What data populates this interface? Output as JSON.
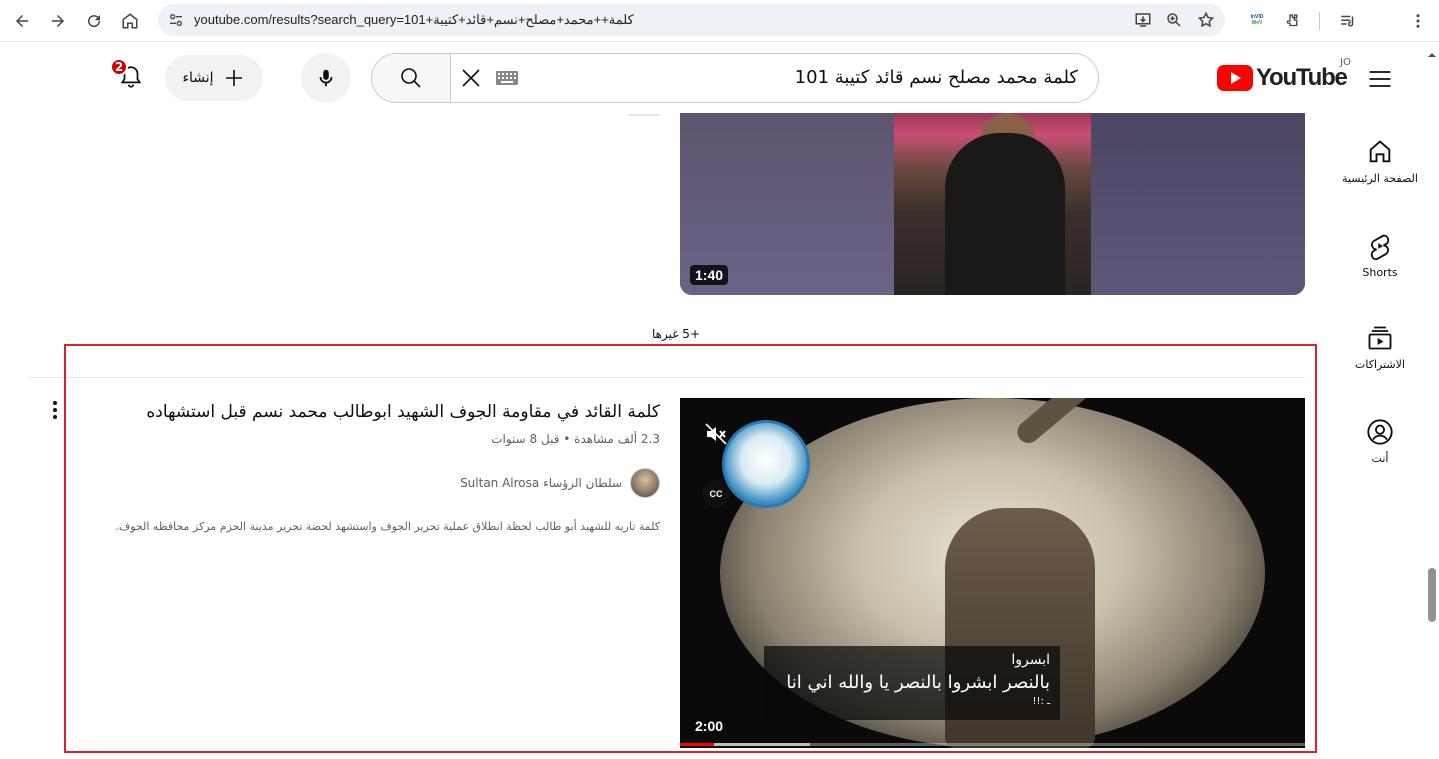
{
  "browser": {
    "url": "youtube.com/results?search_query=101+كلمة++محمد+مصلح+نسم+قائد+كتيبة",
    "ext_badge": "InVID WeVerify"
  },
  "header": {
    "search_value": "كلمة  محمد مصلح نسم قائد كتيبة 101",
    "create_label": "إنشاء",
    "notification_count": "2",
    "logo_text": "YouTube",
    "country_code": "JO"
  },
  "rail": {
    "home": "الصفحة الرئيسية",
    "shorts": "Shorts",
    "subscriptions": "الاشتراكات",
    "you": "أنت"
  },
  "video1": {
    "duration": "1:40"
  },
  "more_label": "+5 غيرها",
  "result": {
    "title": "كلمة القائد في مقاومة الجوف الشهيد ابوطالب محمد نسم قبل استشهاده",
    "stats": "2.3 ألف مشاهدة • قبل 8 سنوات",
    "channel": "سلطان الرؤساء Sultan Alrosa",
    "description": "كلمة تاريه للشهيد أبو طالب لحظة انطلاق عملية تحرير الجوف واستشهد لحضة تحرير مدينة الحزم مركز محافظه الجوف.",
    "duration": "2:00",
    "cc_label": "CC",
    "caption_l1": "ابسروا",
    "caption_l2": "بالنصر ابشروا بالنصر يا والله اني انا",
    "caption_l3": "ـ :!!",
    "progress_fraction": 0.054
  },
  "colors": {
    "brand_red": "#ff0000",
    "highlight_border": "#d6262c"
  }
}
